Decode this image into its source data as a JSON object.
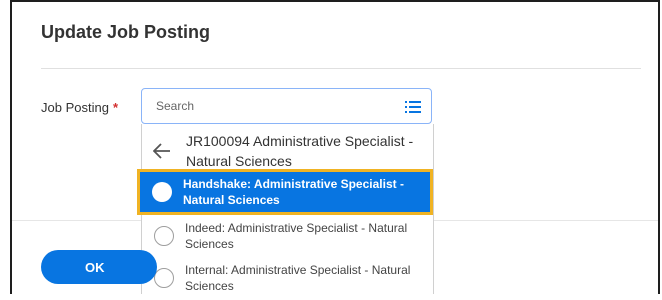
{
  "dialog": {
    "title": "Update Job Posting"
  },
  "field": {
    "label": "Job Posting",
    "required_mark": "*"
  },
  "search": {
    "placeholder": "Search"
  },
  "dropdown": {
    "back_item": "JR100094 Administrative Specialist - Natural Sciences",
    "options": [
      {
        "label": "Handshake: Administrative Specialist - Natural Sciences",
        "selected": true
      },
      {
        "label": "Indeed: Administrative Specialist - Natural Sciences",
        "selected": false
      },
      {
        "label": "Internal: Administrative Specialist - Natural Sciences",
        "selected": false
      }
    ]
  },
  "footer": {
    "ok_label": "OK"
  },
  "colors": {
    "accent": "#0875e1",
    "focus_outline": "#f0b323",
    "required": "#d32f2f"
  },
  "icons": [
    "list-icon",
    "back-arrow-icon",
    "radio-icon"
  ]
}
